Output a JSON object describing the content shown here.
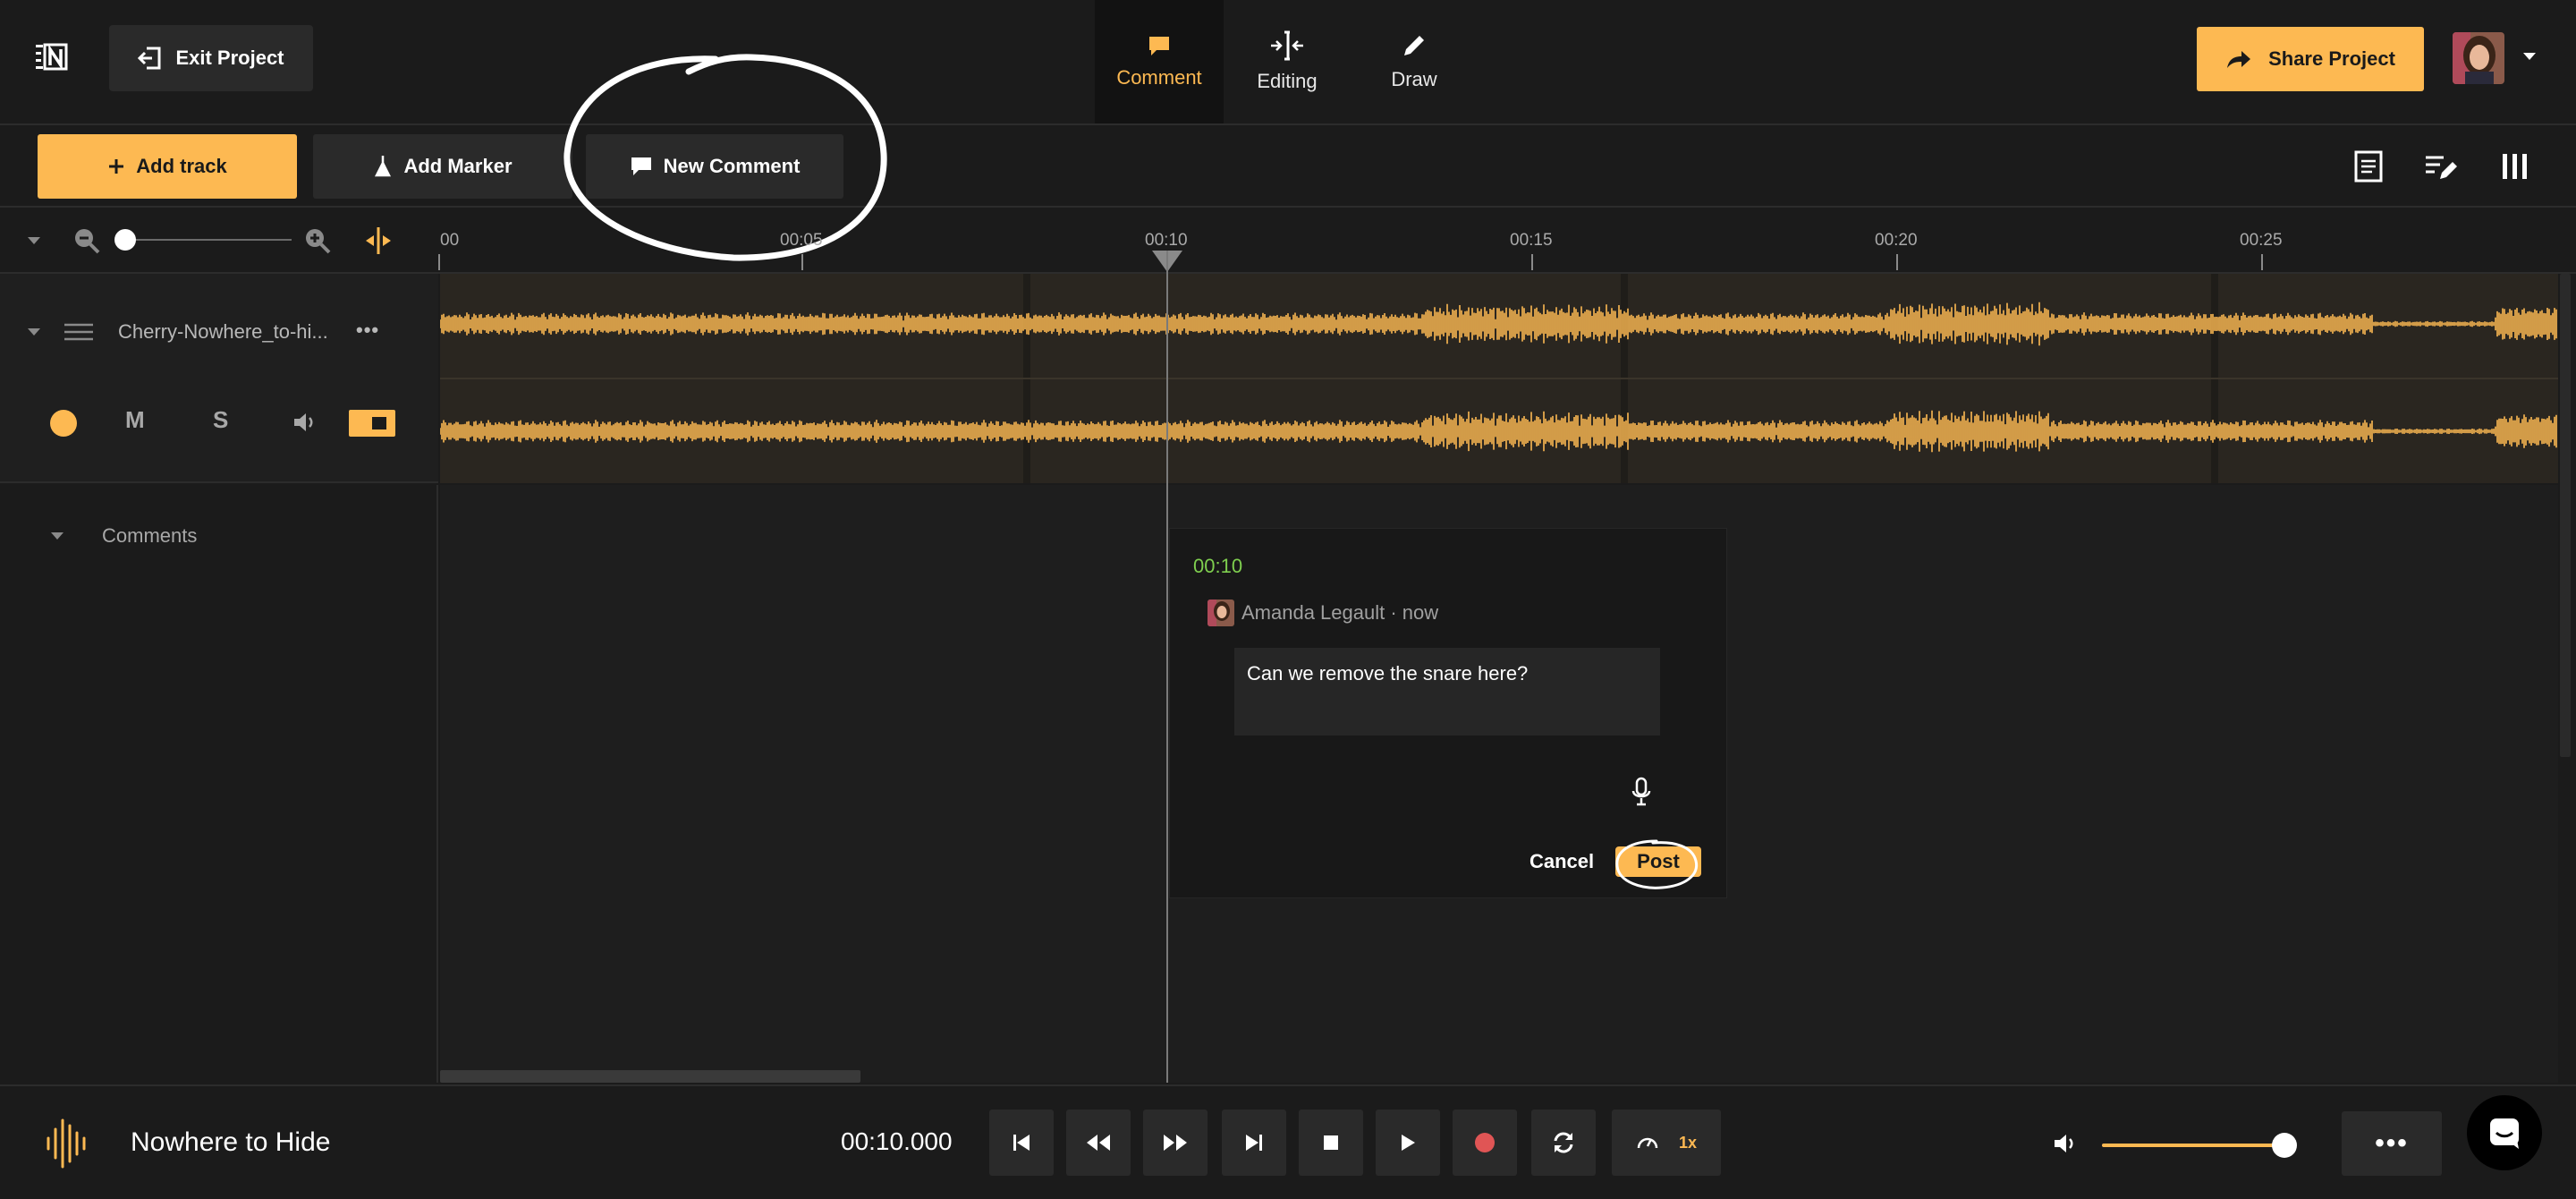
{
  "header": {
    "exit_label": "Exit Project",
    "tabs": [
      {
        "label": "Comment",
        "icon": "comment-icon",
        "active": true
      },
      {
        "label": "Editing",
        "icon": "split-icon",
        "active": false
      },
      {
        "label": "Draw",
        "icon": "pencil-icon",
        "active": false
      }
    ],
    "share_label": "Share Project"
  },
  "toolbar": {
    "add_track_label": "Add track",
    "add_marker_label": "Add Marker",
    "new_comment_label": "New Comment"
  },
  "ruler": {
    "ticks": [
      "00",
      "00:05",
      "00:10",
      "00:15",
      "00:20",
      "00:25"
    ]
  },
  "track": {
    "name": "Cherry-Nowhere_to-hi...",
    "more": "•••",
    "mute": "M",
    "solo": "S"
  },
  "comments_section": {
    "label": "Comments"
  },
  "comment_popup": {
    "timestamp": "00:10",
    "author": "Amanda Legault · now",
    "text": "Can we remove the snare here?",
    "cancel_label": "Cancel",
    "post_label": "Post"
  },
  "transport": {
    "song_title": "Nowhere to Hide",
    "time": "00:10.000",
    "speed": "1x",
    "volume_percent": 100,
    "more": "•••"
  },
  "colors": {
    "accent": "#fdb952",
    "timestamp": "#7fcf4f",
    "record": "#e05555",
    "background": "#1b1b1b"
  }
}
